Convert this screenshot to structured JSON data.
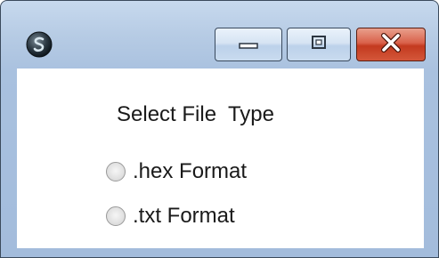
{
  "window": {
    "controls": {
      "minimize_icon": "minimize-icon",
      "maximize_icon": "maximize-icon",
      "close_icon": "close-icon"
    },
    "colors": {
      "close_button": "#c8432a",
      "frame": "#a9c1df"
    }
  },
  "dialog": {
    "title_label": "Select File  Type",
    "options": [
      {
        "label": ".hex Format",
        "selected": false
      },
      {
        "label": ".txt Format",
        "selected": false
      }
    ]
  }
}
